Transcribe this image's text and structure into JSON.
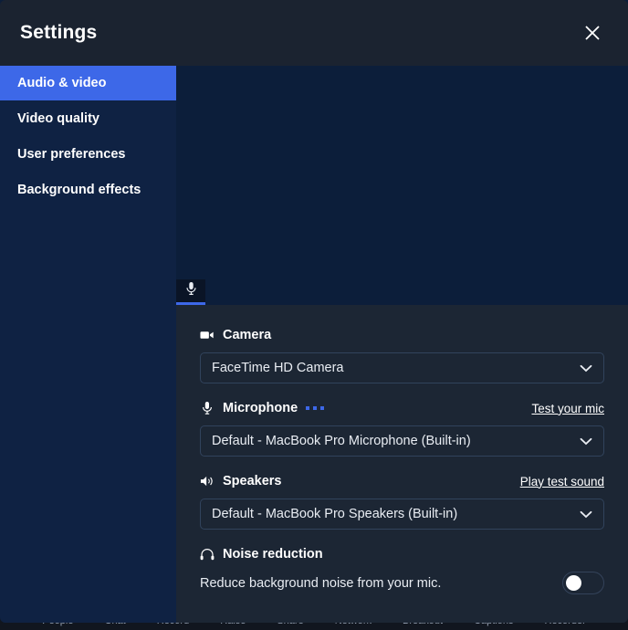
{
  "window": {
    "title": "Settings",
    "close_icon": "close-icon"
  },
  "sidebar": {
    "items": [
      {
        "label": "Audio & video",
        "active": true
      },
      {
        "label": "Video quality",
        "active": false
      },
      {
        "label": "User preferences",
        "active": false
      },
      {
        "label": "Background effects",
        "active": false
      }
    ]
  },
  "video_stage": {
    "mic_tab_icon": "microphone-icon"
  },
  "panel": {
    "camera": {
      "icon": "video-camera-icon",
      "title": "Camera",
      "selected": "FaceTime HD Camera"
    },
    "microphone": {
      "icon": "microphone-icon",
      "title": "Microphone",
      "level_dots": 3,
      "action_label": "Test your mic",
      "selected": "Default - MacBook Pro Microphone (Built-in)"
    },
    "speakers": {
      "icon": "speaker-icon",
      "title": "Speakers",
      "action_label": "Play test sound",
      "selected": "Default - MacBook Pro Speakers (Built-in)"
    },
    "noise_reduction": {
      "icon": "headphones-icon",
      "title": "Noise reduction",
      "description": "Reduce background noise from your mic.",
      "enabled": false
    }
  },
  "callbar": {
    "items": [
      {
        "label": "People"
      },
      {
        "label": "Chat"
      },
      {
        "label": "Record"
      },
      {
        "label": "Raise"
      },
      {
        "label": "Share"
      },
      {
        "label": "Network"
      },
      {
        "label": "Breakout"
      },
      {
        "label": "Captions"
      },
      {
        "label": "Recorder"
      }
    ]
  },
  "colors": {
    "accent": "#3d68e8",
    "panel_bg": "#1c2634",
    "sidebar_bg": "#0f2243",
    "video_bg": "#0c1e3a",
    "titlebar_bg": "#1b2330"
  }
}
